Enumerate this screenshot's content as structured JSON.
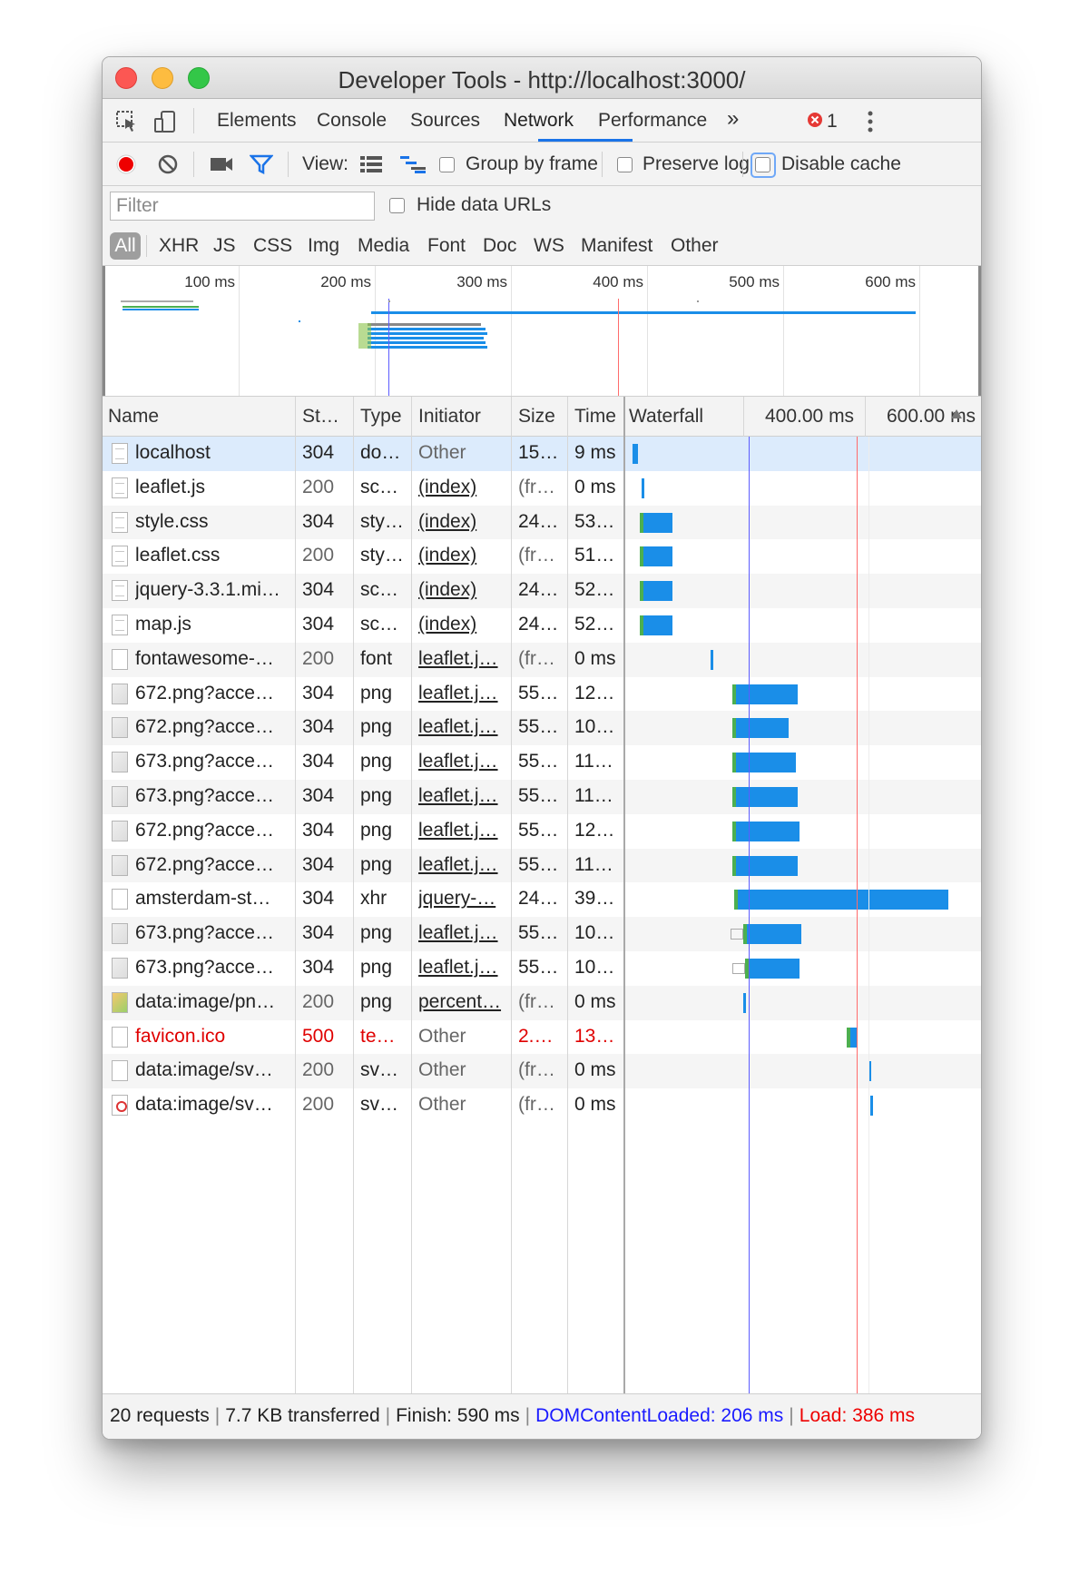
{
  "window": {
    "title": "Developer Tools - http://localhost:3000/"
  },
  "tabs": {
    "items": [
      "Elements",
      "Console",
      "Sources",
      "Network",
      "Performance"
    ],
    "active": "Network",
    "more": "»",
    "error_count": "1"
  },
  "toolbar": {
    "view_label": "View:",
    "group_by_frame": "Group by frame",
    "preserve_log": "Preserve log",
    "disable_cache": "Disable cache"
  },
  "filter": {
    "placeholder": "Filter",
    "hide_data_urls": "Hide data URLs"
  },
  "types": [
    "All",
    "XHR",
    "JS",
    "CSS",
    "Img",
    "Media",
    "Font",
    "Doc",
    "WS",
    "Manifest",
    "Other"
  ],
  "overview": {
    "ticks": [
      "100 ms",
      "200 ms",
      "300 ms",
      "400 ms",
      "500 ms",
      "600 ms"
    ]
  },
  "columns": {
    "name": "Name",
    "status": "St…",
    "type": "Type",
    "initiator": "Initiator",
    "size": "Size",
    "time": "Time",
    "waterfall": "Waterfall",
    "wf_tick1": "400.00 ms",
    "wf_tick2": "600.00 ms"
  },
  "requests": [
    {
      "name": "localhost",
      "status": "304",
      "type": "do…",
      "initiator": "Other",
      "size": "15…",
      "time": "9 ms",
      "icon": "doc"
    },
    {
      "name": "leaflet.js",
      "status": "200",
      "type": "sc…",
      "initiator": "(index)",
      "size": "(fr…",
      "time": "0 ms",
      "icon": "doc"
    },
    {
      "name": "style.css",
      "status": "304",
      "type": "sty…",
      "initiator": "(index)",
      "size": "24…",
      "time": "53…",
      "icon": "doc"
    },
    {
      "name": "leaflet.css",
      "status": "200",
      "type": "sty…",
      "initiator": "(index)",
      "size": "(fr…",
      "time": "51…",
      "icon": "doc"
    },
    {
      "name": "jquery-3.3.1.mi…",
      "status": "304",
      "type": "sc…",
      "initiator": "(index)",
      "size": "24…",
      "time": "52…",
      "icon": "doc"
    },
    {
      "name": "map.js",
      "status": "304",
      "type": "sc…",
      "initiator": "(index)",
      "size": "24…",
      "time": "52…",
      "icon": "doc"
    },
    {
      "name": "fontawesome-…",
      "status": "200",
      "type": "font",
      "initiator": "leaflet.j…",
      "size": "(fr…",
      "time": "0 ms",
      "icon": "blank"
    },
    {
      "name": "672.png?acce…",
      "status": "304",
      "type": "png",
      "initiator": "leaflet.j…",
      "size": "55…",
      "time": "12…",
      "icon": "img"
    },
    {
      "name": "672.png?acce…",
      "status": "304",
      "type": "png",
      "initiator": "leaflet.j…",
      "size": "55…",
      "time": "10…",
      "icon": "img"
    },
    {
      "name": "673.png?acce…",
      "status": "304",
      "type": "png",
      "initiator": "leaflet.j…",
      "size": "55…",
      "time": "11…",
      "icon": "img"
    },
    {
      "name": "673.png?acce…",
      "status": "304",
      "type": "png",
      "initiator": "leaflet.j…",
      "size": "55…",
      "time": "11…",
      "icon": "img"
    },
    {
      "name": "672.png?acce…",
      "status": "304",
      "type": "png",
      "initiator": "leaflet.j…",
      "size": "55…",
      "time": "12…",
      "icon": "img"
    },
    {
      "name": "672.png?acce…",
      "status": "304",
      "type": "png",
      "initiator": "leaflet.j…",
      "size": "55…",
      "time": "11…",
      "icon": "img"
    },
    {
      "name": "amsterdam-st…",
      "status": "304",
      "type": "xhr",
      "initiator": "jquery-…",
      "size": "24…",
      "time": "39…",
      "icon": "blank"
    },
    {
      "name": "673.png?acce…",
      "status": "304",
      "type": "png",
      "initiator": "leaflet.j…",
      "size": "55…",
      "time": "10…",
      "icon": "img"
    },
    {
      "name": "673.png?acce…",
      "status": "304",
      "type": "png",
      "initiator": "leaflet.j…",
      "size": "55…",
      "time": "10…",
      "icon": "img"
    },
    {
      "name": "data:image/pn…",
      "status": "200",
      "type": "png",
      "initiator": "percent…",
      "size": "(fr…",
      "time": "0 ms",
      "icon": "colorimg"
    },
    {
      "name": "favicon.ico",
      "status": "500",
      "type": "te…",
      "initiator": "Other",
      "size": "2.…",
      "time": "13…",
      "icon": "blank",
      "error": true
    },
    {
      "name": "data:image/sv…",
      "status": "200",
      "type": "sv…",
      "initiator": "Other",
      "size": "(fr…",
      "time": "0 ms",
      "icon": "blank"
    },
    {
      "name": "data:image/sv…",
      "status": "200",
      "type": "sv…",
      "initiator": "Other",
      "size": "(fr…",
      "time": "0 ms",
      "icon": "svgred"
    }
  ],
  "summary": {
    "requests": "20 requests",
    "transferred": "7.7 KB transferred",
    "finish": "Finish: 590 ms",
    "domcontentloaded": "DOMContentLoaded: 206 ms",
    "load": "Load: 386 ms"
  },
  "colors": {
    "accent": "#1a73e8",
    "bar": "#1a8ee8",
    "error": "#e00000",
    "dcl": "#2222ff",
    "load": "#e00000"
  }
}
